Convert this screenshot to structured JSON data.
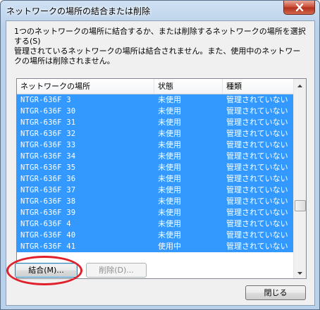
{
  "window": {
    "title": "ネットワークの場所の結合または削除"
  },
  "description": "1つのネットワークの場所に結合するか、または削除するネットワークの場所を選択する(S)\n管理されているネットワークの場所は結合されません。また、使用中のネットワークの場所は削除されません。",
  "list": {
    "columns": [
      "ネットワークの場所",
      "状態",
      "種類"
    ],
    "rows": [
      {
        "name": "NTGR-636F  3",
        "status": "未使用",
        "type": "管理されていない"
      },
      {
        "name": "NTGR-636F  30",
        "status": "未使用",
        "type": "管理されていない"
      },
      {
        "name": "NTGR-636F  31",
        "status": "未使用",
        "type": "管理されていない"
      },
      {
        "name": "NTGR-636F  32",
        "status": "未使用",
        "type": "管理されていない"
      },
      {
        "name": "NTGR-636F  33",
        "status": "未使用",
        "type": "管理されていない"
      },
      {
        "name": "NTGR-636F  34",
        "status": "未使用",
        "type": "管理されていない"
      },
      {
        "name": "NTGR-636F  35",
        "status": "未使用",
        "type": "管理されていない"
      },
      {
        "name": "NTGR-636F  36",
        "status": "未使用",
        "type": "管理されていない"
      },
      {
        "name": "NTGR-636F  37",
        "status": "未使用",
        "type": "管理されていない"
      },
      {
        "name": "NTGR-636F  38",
        "status": "未使用",
        "type": "管理されていない"
      },
      {
        "name": "NTGR-636F  39",
        "status": "未使用",
        "type": "管理されていない"
      },
      {
        "name": "NTGR-636F  4",
        "status": "未使用",
        "type": "管理されていない"
      },
      {
        "name": "NTGR-636F  40",
        "status": "未使用",
        "type": "管理されていない"
      },
      {
        "name": "NTGR-636F  41",
        "status": "使用中",
        "type": "管理されていない"
      }
    ]
  },
  "buttons": {
    "merge": "結合(M)...",
    "delete": "削除(D)...",
    "close": "閉じる"
  },
  "colors": {
    "selection": "#3399ff",
    "highlight_ring": "#e0202a"
  },
  "icons": {
    "window_close": "close-icon",
    "scroll_up": "chevron-up-icon",
    "scroll_down": "chevron-down-icon"
  }
}
